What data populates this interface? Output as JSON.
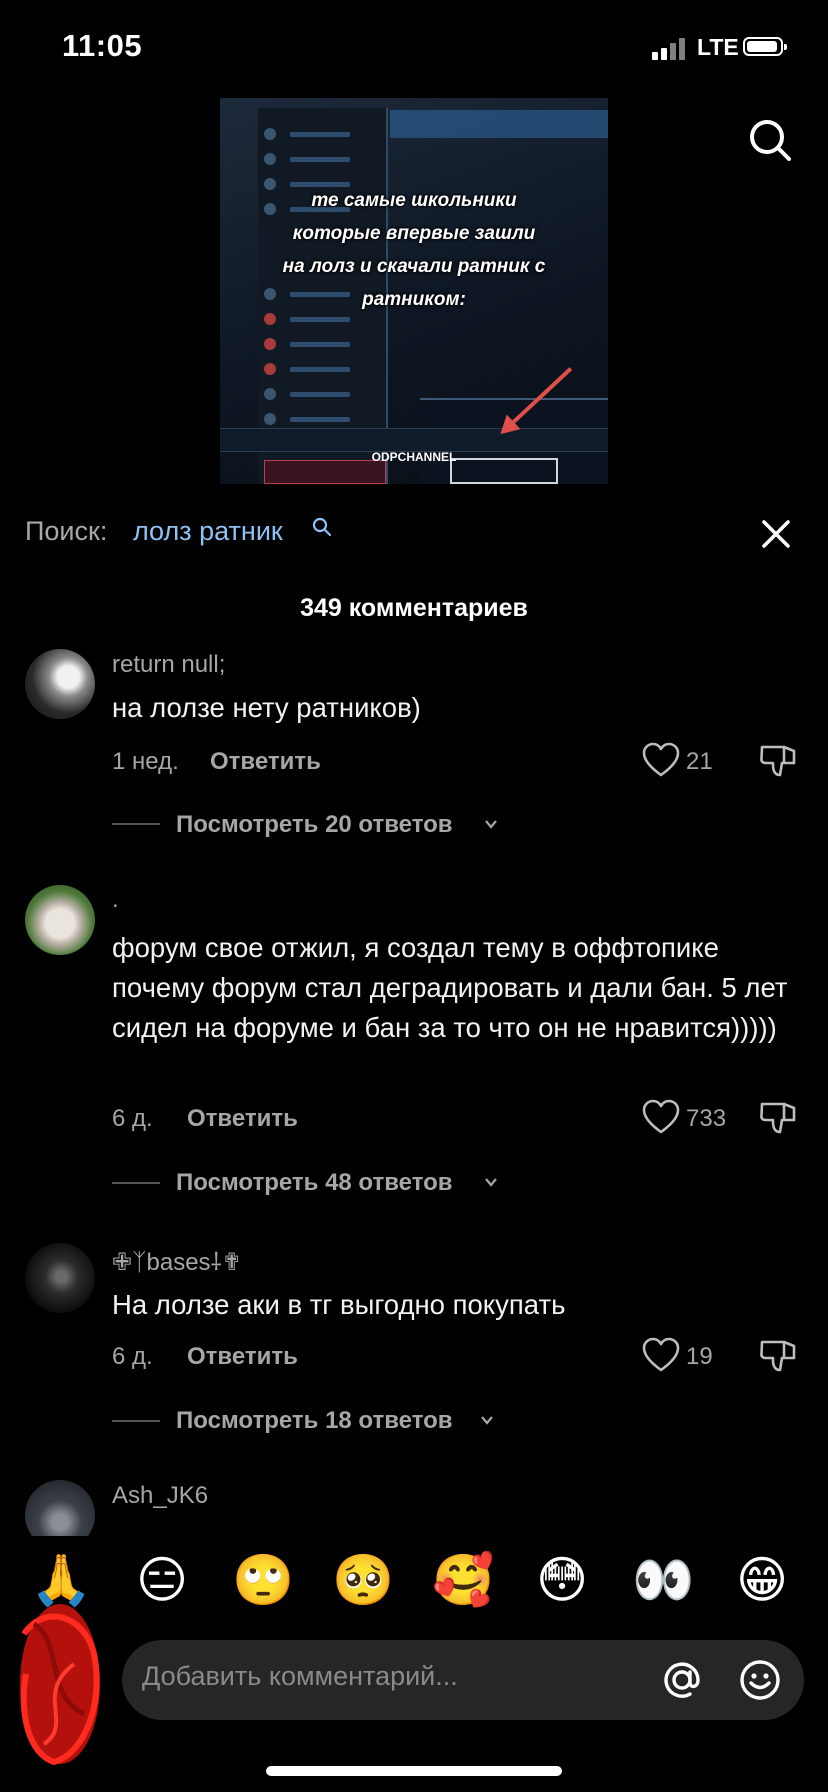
{
  "status_bar": {
    "time": "11:05",
    "network": "LTE"
  },
  "video": {
    "caption": "те самые школьники\nкоторые впервые зашли\nна лолз и скачали ратник с\nратником:",
    "watermark": "ODPCHANNEL"
  },
  "search": {
    "label": "Поиск:",
    "query": "лолз ратник"
  },
  "comments_count": "349 комментариев",
  "comments": [
    {
      "username": "return null;",
      "text": "на лолзе нету ратников)",
      "time": "1 нед.",
      "reply_label": "Ответить",
      "likes": "21",
      "view_replies": "Посмотреть 20 ответов"
    },
    {
      "username": ".",
      "text": "форум свое отжил, я создал тему в оффтопике почему форум стал деградировать и дали бан. 5 лет сидел на форуме и бан за то что он не нравится)))))",
      "time": "6 д.",
      "reply_label": "Ответить",
      "likes": "733",
      "view_replies": "Посмотреть 48 ответов"
    },
    {
      "username": "✙ᛉbases⸸✟",
      "text": "На лолзе аки в тг выгодно покупать",
      "time": "6 д.",
      "reply_label": "Ответить",
      "likes": "19",
      "view_replies": "Посмотреть 18 ответов"
    },
    {
      "username": "Ash_JK6"
    }
  ],
  "emojis": [
    "🙏",
    "😑",
    "🙄",
    "🥺",
    "🥰",
    "😳",
    "👀",
    "😁"
  ],
  "comment_input": {
    "placeholder": "Добавить комментарий..."
  },
  "colors": {
    "background": "#000000",
    "search_query": "#8ec1f5",
    "secondary_text": "#a6a6a6"
  }
}
